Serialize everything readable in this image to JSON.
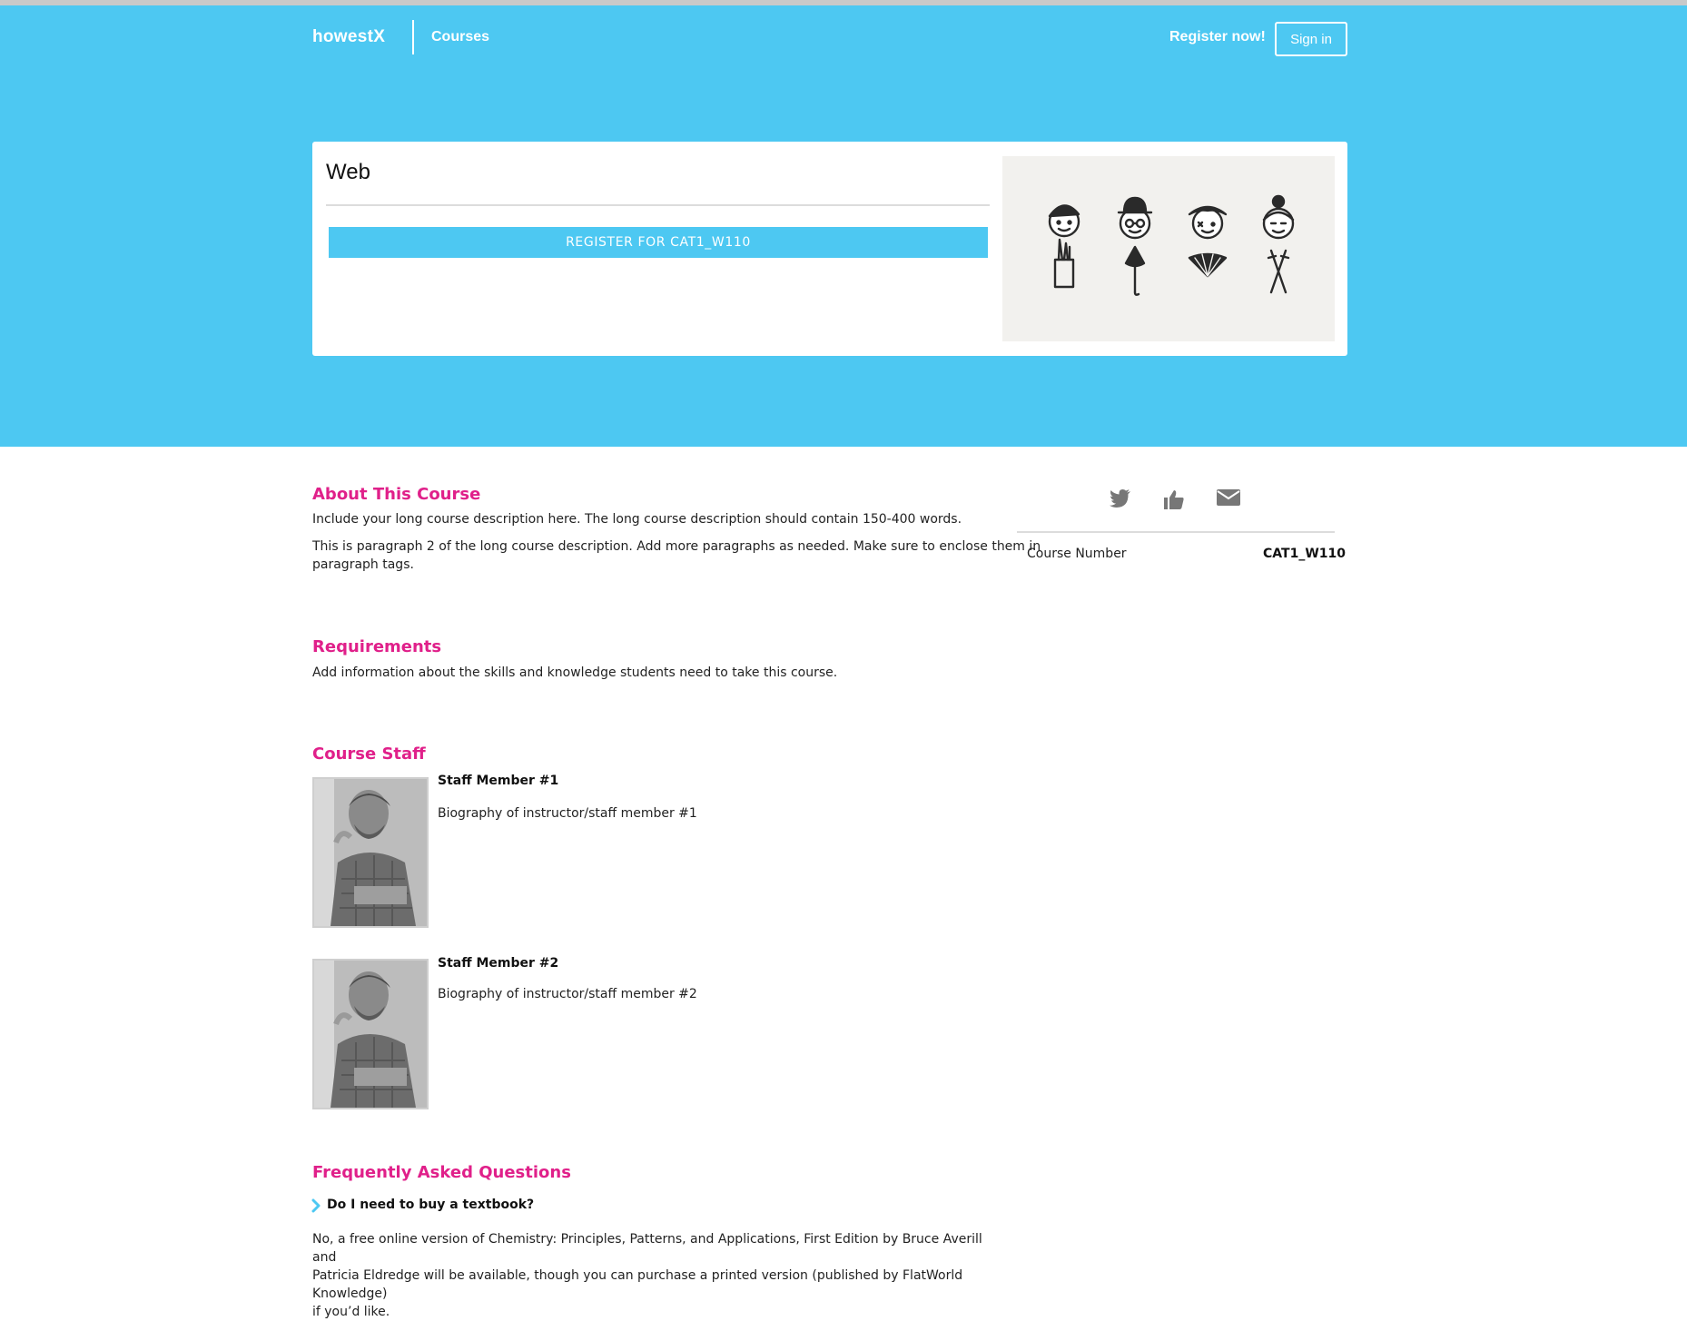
{
  "header": {
    "logo": "howestX",
    "nav_courses": "Courses",
    "register_now": "Register now!",
    "sign_in": "Sign in"
  },
  "course": {
    "title": "Web",
    "register_button": "REGISTER FOR CAT1_W110",
    "number_label": "Course Number",
    "number_value": "CAT1_W110"
  },
  "about": {
    "heading": "About This Course",
    "p1": "Include your long course description here. The long course description should contain 150-400 words.",
    "p2_line1": "This is paragraph 2 of the long course description. Add more paragraphs as needed. Make sure to enclose them in",
    "p2_line2": "paragraph tags."
  },
  "requirements": {
    "heading": "Requirements",
    "text": "Add information about the skills and knowledge students need to take this course."
  },
  "staff": {
    "heading": "Course Staff",
    "members": [
      {
        "name": "Staff Member #1",
        "bio": "Biography of instructor/staff member #1"
      },
      {
        "name": "Staff Member #2",
        "bio": "Biography of instructor/staff member #2"
      }
    ]
  },
  "faq": {
    "heading": "Frequently Asked Questions",
    "question": "Do I need to buy a textbook?",
    "answer_line1": "No, a free online version of Chemistry: Principles, Patterns, and Applications, First Edition by Bruce Averill and",
    "answer_line2": "Patricia Eldredge will be available, though you can purchase a printed version (published by FlatWorld Knowledge)",
    "answer_line3": "if you’d like."
  },
  "share": [
    "twitter-icon",
    "thumbs-up-icon",
    "envelope-icon"
  ],
  "colors": {
    "hero_blue": "#4dc8f2",
    "heading_pink": "#e0208a",
    "icon_gray": "#777777"
  }
}
